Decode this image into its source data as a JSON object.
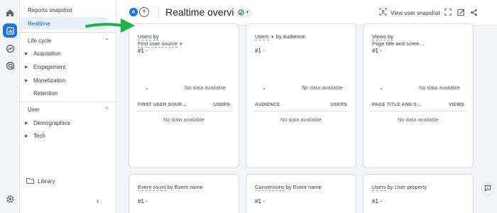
{
  "sidebar": {
    "top_items": [
      {
        "label": "Reports snapshot"
      },
      {
        "label": "Realtime"
      }
    ],
    "lifecycle": {
      "header": "Life cycle",
      "items": [
        {
          "label": "Acquisition",
          "expandable": true
        },
        {
          "label": "Engagement",
          "expandable": true
        },
        {
          "label": "Monetization",
          "expandable": true
        },
        {
          "label": "Retention",
          "expandable": false
        }
      ]
    },
    "user": {
      "header": "User",
      "items": [
        {
          "label": "Demographics",
          "expandable": true
        },
        {
          "label": "Tech",
          "expandable": true
        }
      ]
    },
    "library_label": "Library"
  },
  "header": {
    "avatar_letter": "A",
    "add_label": "+",
    "title": "Realtime overview",
    "snapshot_label": "View user snapshot"
  },
  "cards": [
    {
      "title_prefix": "Users by",
      "title_line2": "First user source",
      "rank": "#1 -",
      "no_data": "No data available",
      "col1": "FIRST USER SOUR…",
      "col2": "USERS",
      "no_data_table": "No data available"
    },
    {
      "title_prefix": "Users",
      "title_suffix": "by Audience",
      "rank": "#1 -",
      "no_data": "No data available",
      "col1": "AUDIENCE",
      "col2": "USERS",
      "no_data_table": "No data available"
    },
    {
      "title_prefix": "Views by",
      "title_line2": "Page title and scree…",
      "rank": "#1 -",
      "no_data": "No data available",
      "col1": "PAGE TITLE AND S…",
      "col2": "VIEWS",
      "no_data_table": "No data available"
    }
  ],
  "bottom_cards": [
    {
      "title_prefix": "Event count",
      "title_suffix": "by Event name",
      "rank": "#1 -"
    },
    {
      "title_prefix": "Conversions",
      "title_suffix": "by Event name",
      "rank": "#1 -"
    },
    {
      "title_prefix": "Users",
      "title_suffix": "by User property",
      "rank": "#1 -"
    }
  ],
  "colors": {
    "accent": "#1a73e8",
    "selected_bg": "#e8f0fe",
    "arrow": "#1fb24a"
  },
  "icons": {
    "rail": [
      "home-icon",
      "reports-icon",
      "explore-icon",
      "advertising-icon",
      "settings-icon"
    ],
    "header": [
      "snapshot-icon",
      "fullscreen-icon",
      "edit-icon",
      "share-icon"
    ]
  }
}
